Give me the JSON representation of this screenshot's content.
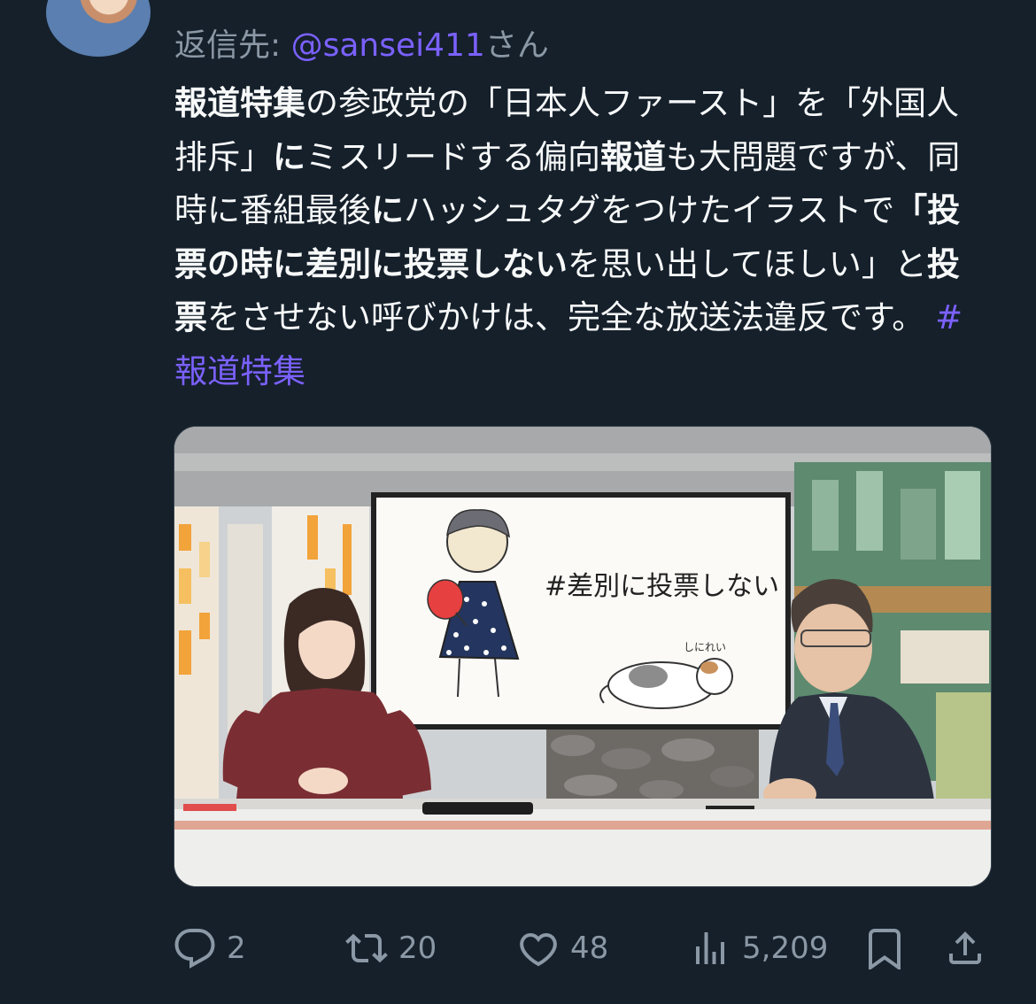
{
  "reply": {
    "prefix": "返信先: ",
    "mention": "@sansei411",
    "suffix": "さん"
  },
  "tweet": {
    "segments": [
      {
        "text": "報道特集",
        "style": "bold"
      },
      {
        "text": "の参政党の「日本人ファースト」を",
        "style": "normal"
      },
      {
        "text": "「外国人排斥」",
        "style": "normal"
      },
      {
        "text": "に",
        "style": "bold"
      },
      {
        "text": "ミスリードする偏向",
        "style": "normal"
      },
      {
        "text": "報道",
        "style": "bold"
      },
      {
        "text": "も大問題ですが、同時に番組最後",
        "style": "normal"
      },
      {
        "text": "に",
        "style": "bold"
      },
      {
        "text": "ハッシュタグをつけたイラストで",
        "style": "normal"
      },
      {
        "text": "「投票の時に差別に投票しない",
        "style": "bold"
      },
      {
        "text": "を思い出してほしい」と",
        "style": "normal"
      },
      {
        "text": "投票",
        "style": "bold"
      },
      {
        "text": "をさせない呼びかけは、完全な放送法違反です。 ",
        "style": "normal"
      },
      {
        "text": "#報道特集",
        "style": "hashtag"
      }
    ]
  },
  "media": {
    "board_text": "#差別に投票しない",
    "board_signature": "しにれい"
  },
  "actions": {
    "replies": "2",
    "retweets": "20",
    "likes": "48",
    "views": "5,209"
  },
  "icons": {
    "reply": "reply-icon",
    "retweet": "retweet-icon",
    "like": "heart-icon",
    "views": "views-icon",
    "bookmark": "bookmark-icon",
    "share": "share-icon"
  },
  "colors": {
    "background": "#15202b",
    "text": "#f7f9f9",
    "muted": "#8b98a5",
    "accent": "#7b61ff"
  }
}
